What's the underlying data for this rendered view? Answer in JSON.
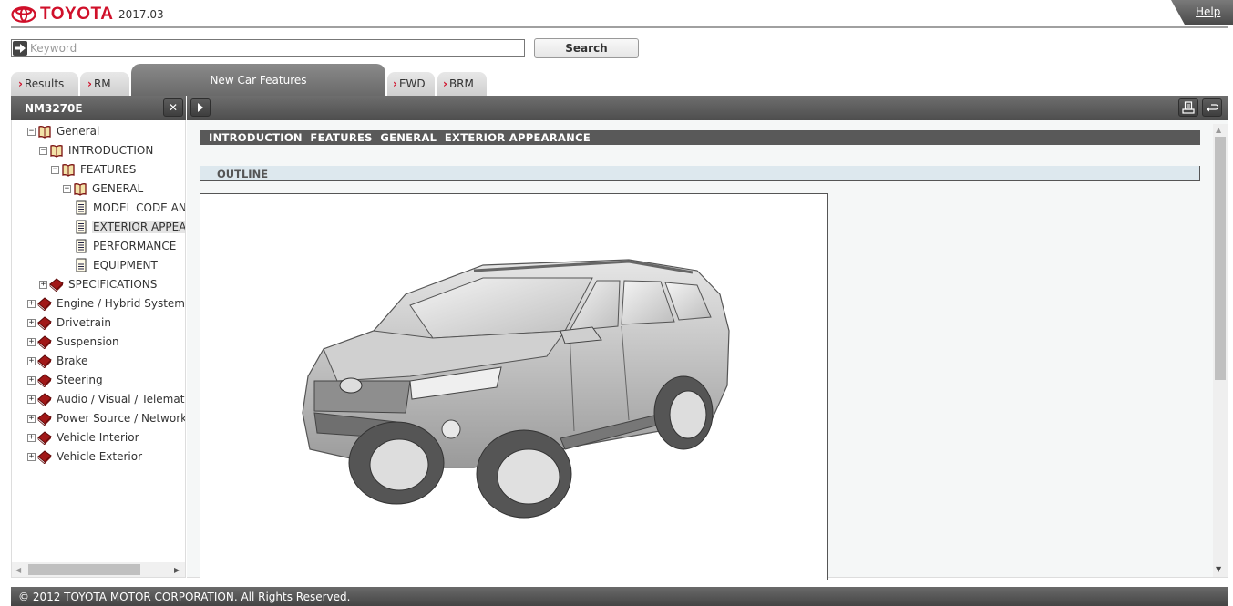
{
  "header": {
    "brand": "TOYOTA",
    "version": "2017.03",
    "help_label": "Help",
    "brand_color": "#d0102a"
  },
  "search": {
    "placeholder": "Keyword",
    "value": "",
    "button_label": "Search"
  },
  "tabs": [
    {
      "label": "Results",
      "active": false
    },
    {
      "label": "RM",
      "active": false
    },
    {
      "label": "New Car Features",
      "active": true
    },
    {
      "label": "EWD",
      "active": false
    },
    {
      "label": "BRM",
      "active": false
    }
  ],
  "left_panel": {
    "title": "NM3270E",
    "close_icon": "close-icon",
    "expand_icon": "play-right-icon"
  },
  "tree": [
    {
      "label": "General",
      "level": 0,
      "state": "expanded",
      "icon": "open-book-icon"
    },
    {
      "label": "INTRODUCTION",
      "level": 1,
      "state": "expanded",
      "icon": "open-book-icon"
    },
    {
      "label": "FEATURES",
      "level": 2,
      "state": "expanded",
      "icon": "open-book-icon"
    },
    {
      "label": "GENERAL",
      "level": 3,
      "state": "expanded",
      "icon": "open-book-icon"
    },
    {
      "label": "MODEL CODE AND",
      "level": 4,
      "state": "leaf",
      "icon": "document-icon"
    },
    {
      "label": "EXTERIOR APPEAR",
      "level": 4,
      "state": "leaf",
      "icon": "document-icon",
      "selected": true
    },
    {
      "label": "PERFORMANCE",
      "level": 4,
      "state": "leaf",
      "icon": "document-icon"
    },
    {
      "label": "EQUIPMENT",
      "level": 4,
      "state": "leaf",
      "icon": "document-icon"
    },
    {
      "label": "SPECIFICATIONS",
      "level": 1,
      "state": "collapsed",
      "icon": "closed-book-icon"
    },
    {
      "label": "Engine / Hybrid System",
      "level": 0,
      "state": "collapsed",
      "icon": "closed-book-icon"
    },
    {
      "label": "Drivetrain",
      "level": 0,
      "state": "collapsed",
      "icon": "closed-book-icon"
    },
    {
      "label": "Suspension",
      "level": 0,
      "state": "collapsed",
      "icon": "closed-book-icon"
    },
    {
      "label": "Brake",
      "level": 0,
      "state": "collapsed",
      "icon": "closed-book-icon"
    },
    {
      "label": "Steering",
      "level": 0,
      "state": "collapsed",
      "icon": "closed-book-icon"
    },
    {
      "label": "Audio / Visual / Telematic",
      "level": 0,
      "state": "collapsed",
      "icon": "closed-book-icon"
    },
    {
      "label": "Power Source / Network",
      "level": 0,
      "state": "collapsed",
      "icon": "closed-book-icon"
    },
    {
      "label": "Vehicle Interior",
      "level": 0,
      "state": "collapsed",
      "icon": "closed-book-icon"
    },
    {
      "label": "Vehicle Exterior",
      "level": 0,
      "state": "collapsed",
      "icon": "closed-book-icon"
    }
  ],
  "content": {
    "breadcrumb": "INTRODUCTION  FEATURES  GENERAL  EXTERIOR APPEARANCE",
    "section_title": "OUTLINE",
    "figure": "SUV exterior line drawing",
    "print_icon": "print-icon",
    "back_icon": "return-icon"
  },
  "footer": {
    "copyright": "© 2012 TOYOTA MOTOR CORPORATION. All Rights Reserved."
  }
}
